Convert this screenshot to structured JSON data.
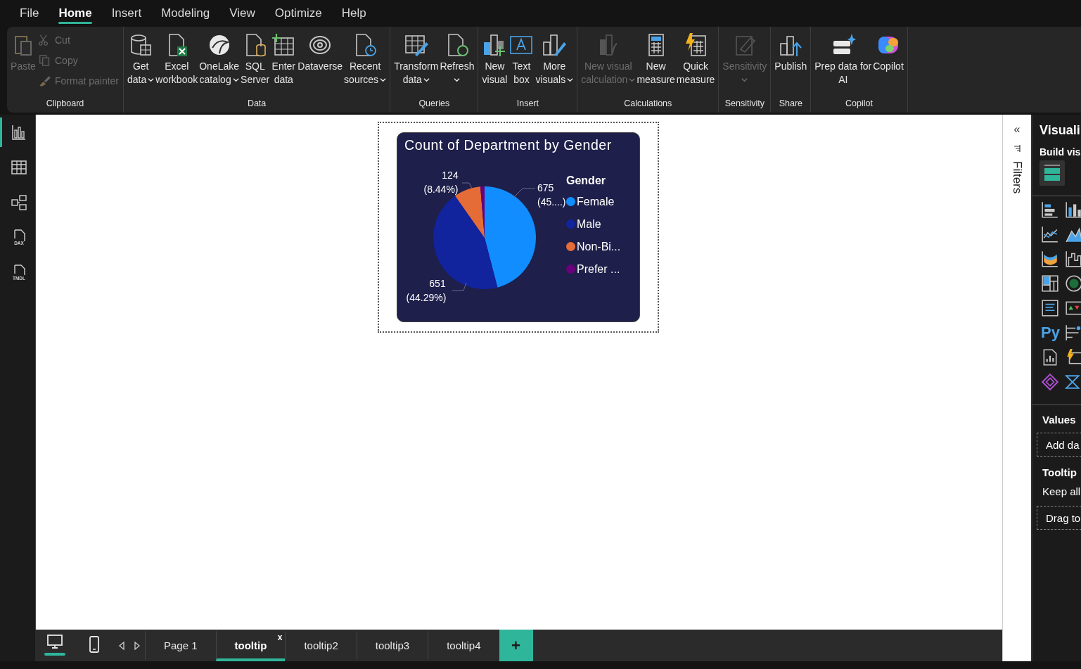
{
  "menu": [
    {
      "label": "File",
      "selected": false
    },
    {
      "label": "Home",
      "selected": true
    },
    {
      "label": "Insert",
      "selected": false
    },
    {
      "label": "Modeling",
      "selected": false
    },
    {
      "label": "View",
      "selected": false
    },
    {
      "label": "Optimize",
      "selected": false
    },
    {
      "label": "Help",
      "selected": false
    }
  ],
  "ribbon": [
    {
      "label": "Clipboard",
      "items": [
        {
          "kind": "large",
          "lines": [
            "Paste"
          ],
          "disabled": true
        },
        {
          "kind": "small",
          "lines": [
            "Cut"
          ],
          "disabled": true
        },
        {
          "kind": "small",
          "lines": [
            "Copy"
          ],
          "disabled": true
        },
        {
          "kind": "small",
          "lines": [
            "Format painter"
          ],
          "disabled": true
        }
      ]
    },
    {
      "label": "Data",
      "items": [
        {
          "kind": "large",
          "lines": [
            "Get",
            "data"
          ],
          "disabled": false,
          "dropdown": true
        },
        {
          "kind": "large",
          "lines": [
            "Excel",
            "workbook"
          ],
          "disabled": false
        },
        {
          "kind": "large",
          "lines": [
            "OneLake",
            "catalog"
          ],
          "disabled": false,
          "dropdown": true
        },
        {
          "kind": "large",
          "lines": [
            "SQL",
            "Server"
          ],
          "disabled": false
        },
        {
          "kind": "large",
          "lines": [
            "Enter",
            "data"
          ],
          "disabled": false
        },
        {
          "kind": "large",
          "lines": [
            "Dataverse"
          ],
          "disabled": false
        },
        {
          "kind": "large",
          "lines": [
            "Recent",
            "sources"
          ],
          "disabled": false,
          "dropdown": true
        }
      ]
    },
    {
      "label": "Queries",
      "items": [
        {
          "kind": "large",
          "lines": [
            "Transform",
            "data"
          ],
          "disabled": false,
          "dropdown": true
        },
        {
          "kind": "large",
          "lines": [
            "Refresh"
          ],
          "disabled": false,
          "dropdown": true
        }
      ]
    },
    {
      "label": "Insert",
      "items": [
        {
          "kind": "large",
          "lines": [
            "New",
            "visual"
          ],
          "disabled": false
        },
        {
          "kind": "large",
          "lines": [
            "Text",
            "box"
          ],
          "disabled": false
        },
        {
          "kind": "large",
          "lines": [
            "More",
            "visuals"
          ],
          "disabled": false,
          "dropdown": true
        }
      ]
    },
    {
      "label": "Calculations",
      "items": [
        {
          "kind": "large",
          "lines": [
            "New visual",
            "calculation"
          ],
          "disabled": true,
          "dropdown": true
        },
        {
          "kind": "large",
          "lines": [
            "New",
            "measure"
          ],
          "disabled": false
        },
        {
          "kind": "large",
          "lines": [
            "Quick",
            "measure"
          ],
          "disabled": false
        }
      ]
    },
    {
      "label": "Sensitivity",
      "items": [
        {
          "kind": "large",
          "lines": [
            "Sensitivity"
          ],
          "disabled": true,
          "dropdown": true
        }
      ]
    },
    {
      "label": "Share",
      "items": [
        {
          "kind": "large",
          "lines": [
            "Publish"
          ],
          "disabled": false
        }
      ]
    },
    {
      "label": "Copilot",
      "items": [
        {
          "kind": "large",
          "lines": [
            "Prep data for",
            "AI"
          ],
          "disabled": false
        },
        {
          "kind": "large",
          "lines": [
            "Copilot"
          ],
          "disabled": false
        }
      ]
    }
  ],
  "views": [
    {
      "selected": true
    },
    {
      "selected": false
    },
    {
      "selected": false
    },
    {
      "selected": false,
      "label": "DAX"
    },
    {
      "selected": false,
      "label": "TMDL"
    }
  ],
  "visual": {
    "chart_data": {
      "type": "pie",
      "title": "Count of Department by Gender",
      "categories": [
        "Female",
        "Male",
        "Non-Bi...",
        "Prefer ..."
      ],
      "values": [
        45.95,
        44.29,
        8.44,
        1.32
      ]
    },
    "slice_labels": [
      {
        "value": "124",
        "share": "(8.44%)"
      },
      {
        "value": "675",
        "share": "(45....)"
      },
      {
        "value": "651",
        "share": "(44.29%)"
      }
    ],
    "legend": {
      "title": "Gender",
      "items": [
        {
          "color": "#118dff"
        },
        {
          "color": "#12239e"
        },
        {
          "color": "#e66c37"
        },
        {
          "color": "#6b007b"
        }
      ]
    }
  },
  "filters_pane": {
    "collapse_glyph": "«",
    "title": "Filters"
  },
  "viz_pane": {
    "title": "Visuali",
    "subtitle": "Build vis",
    "python_glyph": "Py",
    "wells": [
      {
        "kind": "header",
        "text": "Values"
      },
      {
        "kind": "field",
        "placeholder": "Add da"
      },
      {
        "kind": "header",
        "text": "Tooltip"
      },
      {
        "kind": "text",
        "text": "Keep all"
      },
      {
        "kind": "field",
        "placeholder": "Drag to"
      }
    ]
  },
  "layouts": [
    {
      "selected": true
    },
    {
      "selected": false
    }
  ],
  "pages": [
    {
      "label": "Page 1",
      "selected": false
    },
    {
      "label": "tooltip",
      "selected": true,
      "close_glyph": "x"
    },
    {
      "label": "tooltip2",
      "selected": false
    },
    {
      "label": "tooltip3",
      "selected": false
    },
    {
      "label": "tooltip4",
      "selected": false
    }
  ],
  "add_page": "+"
}
